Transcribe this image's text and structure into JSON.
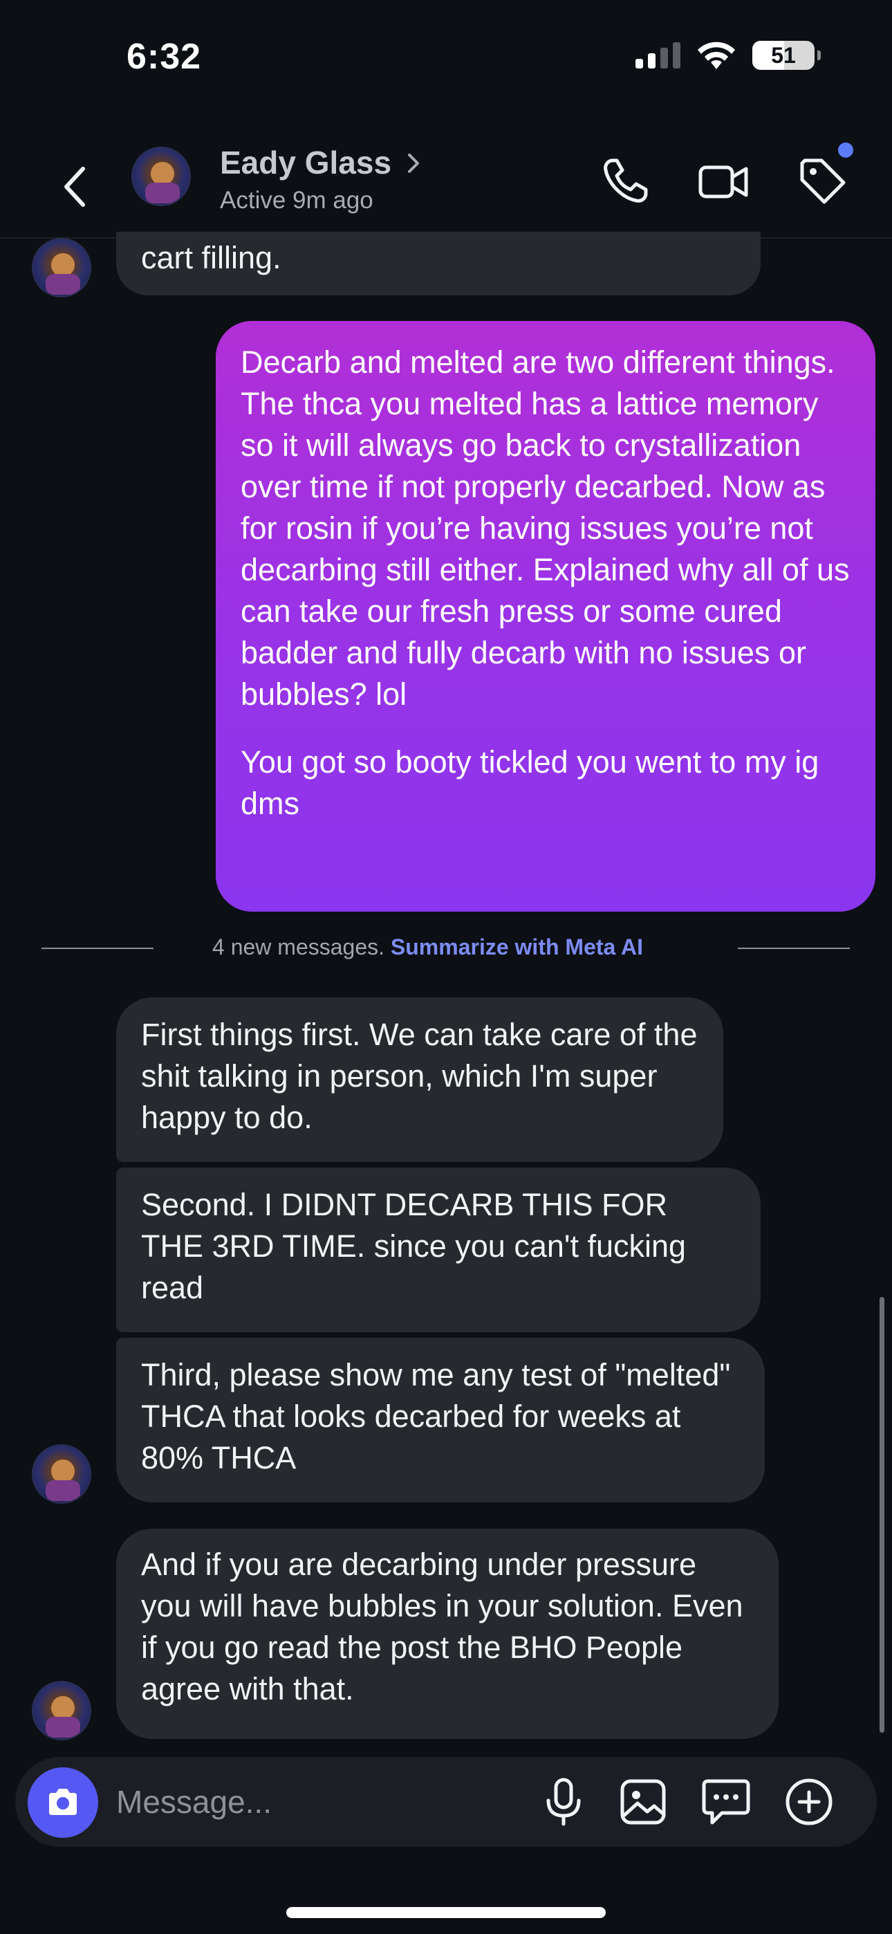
{
  "status_bar": {
    "time": "6:32",
    "battery": "51"
  },
  "header": {
    "contact_name": "Eady Glass",
    "contact_status": "Active 9m ago",
    "icons": [
      "back-icon",
      "chevron-right-icon",
      "phone-icon",
      "video-camera-icon",
      "tag-icon"
    ]
  },
  "messages": {
    "partial_incoming": "cart filling.",
    "outgoing_p1": "Decarb and melted are two different things. The thca you melted has a lattice memory so it will always go back to crystallization over time if not properly decarbed. Now as for rosin if you’re having issues you’re not decarbing still either. Explained why all of us can take our fresh press or some cured badder and fully decarb with no issues or bubbles? lol",
    "outgoing_p2": "You got so booty tickled you went to my ig dms",
    "incoming": [
      "First things first. We can take care of the shit talking in person, which I'm super happy to do.",
      "Second. I DIDNT DECARB THIS FOR THE 3RD TIME. since you can't fucking read",
      "Third, please show me any test of \"melted\" THCA that looks decarbed for weeks at 80% THCA",
      "And if you are decarbing under pressure you will have bubbles in your solution. Even if you go read the post the BHO People agree with that."
    ]
  },
  "divider": {
    "text": "4 new messages.",
    "link": "Summarize with Meta AI"
  },
  "composer": {
    "placeholder": "Message...",
    "icons": [
      "camera-icon",
      "microphone-icon",
      "image-icon",
      "chat-icon",
      "plus-circle-icon"
    ]
  },
  "colors": {
    "accent": "#5658f3",
    "outgoing_top": "#b12fd6",
    "outgoing_bottom": "#8b35ee",
    "incoming_bg": "#26292e",
    "link": "#7d8cf2"
  }
}
